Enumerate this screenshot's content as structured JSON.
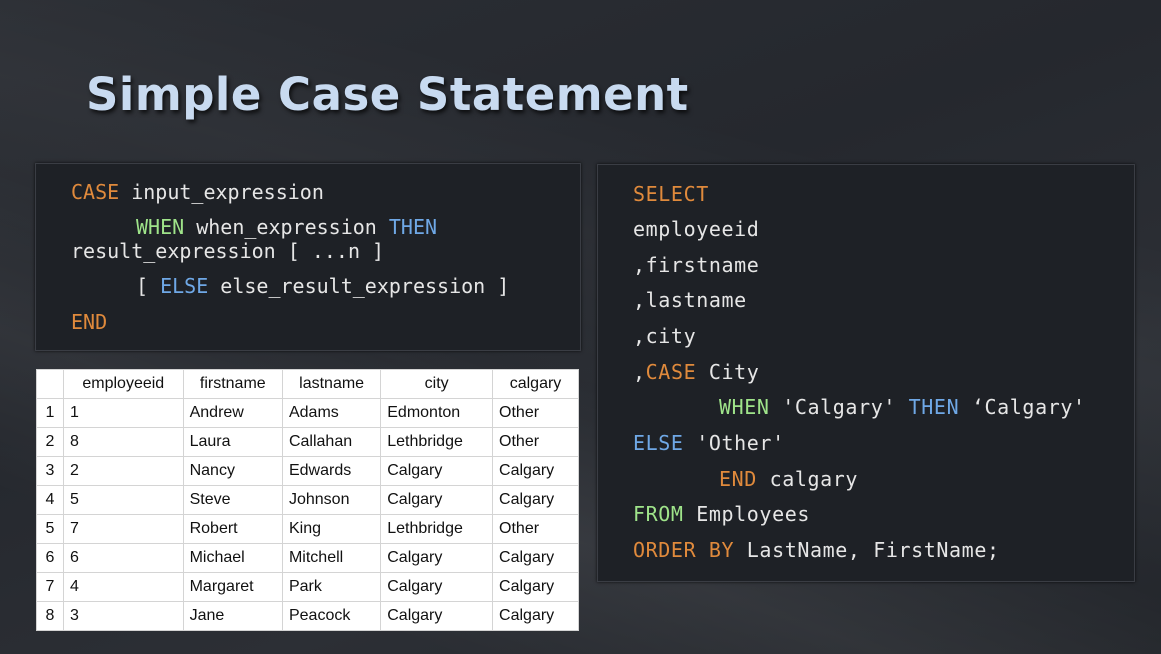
{
  "title": "Simple Case Statement",
  "syntax": {
    "line1": {
      "kw": "CASE",
      "rest": " input_expression"
    },
    "line2": {
      "kw": "WHEN",
      "mid": " when_expression ",
      "kw2": "THEN"
    },
    "line3": "result_expression [ ...n ]",
    "line4": {
      "pre": "[ ",
      "kw": "ELSE",
      "rest": " else_result_expression ]"
    },
    "line5": {
      "kw": "END"
    }
  },
  "query": {
    "l1": "SELECT",
    "l2": "employeeid",
    "l3": ",firstname",
    "l4": ",lastname",
    "l5": ",city",
    "l6": {
      "pre": ",",
      "kw": "CASE",
      "rest": " City"
    },
    "l7": {
      "kw": "WHEN",
      "mid": " 'Calgary' ",
      "kw2": "THEN",
      "rest": " ‘Calgary'"
    },
    "l8": {
      "kw": "ELSE",
      "rest": " 'Other'"
    },
    "l9": {
      "kw": "END",
      "rest": " calgary"
    },
    "l10": {
      "kw": "FROM",
      "rest": " Employees"
    },
    "l11": {
      "kw": "ORDER BY",
      "rest": " LastName, FirstName;"
    }
  },
  "results": {
    "columns": [
      "employeeid",
      "firstname",
      "lastname",
      "city",
      "calgary"
    ],
    "rows": [
      {
        "n": "1",
        "cells": [
          "1",
          "Andrew",
          "Adams",
          "Edmonton",
          "Other"
        ]
      },
      {
        "n": "2",
        "cells": [
          "8",
          "Laura",
          "Callahan",
          "Lethbridge",
          "Other"
        ]
      },
      {
        "n": "3",
        "cells": [
          "2",
          "Nancy",
          "Edwards",
          "Calgary",
          "Calgary"
        ]
      },
      {
        "n": "4",
        "cells": [
          "5",
          "Steve",
          "Johnson",
          "Calgary",
          "Calgary"
        ]
      },
      {
        "n": "5",
        "cells": [
          "7",
          "Robert",
          "King",
          "Lethbridge",
          "Other"
        ]
      },
      {
        "n": "6",
        "cells": [
          "6",
          "Michael",
          "Mitchell",
          "Calgary",
          "Calgary"
        ]
      },
      {
        "n": "7",
        "cells": [
          "4",
          "Margaret",
          "Park",
          "Calgary",
          "Calgary"
        ]
      },
      {
        "n": "8",
        "cells": [
          "3",
          "Jane",
          "Peacock",
          "Calgary",
          "Calgary"
        ]
      }
    ]
  }
}
